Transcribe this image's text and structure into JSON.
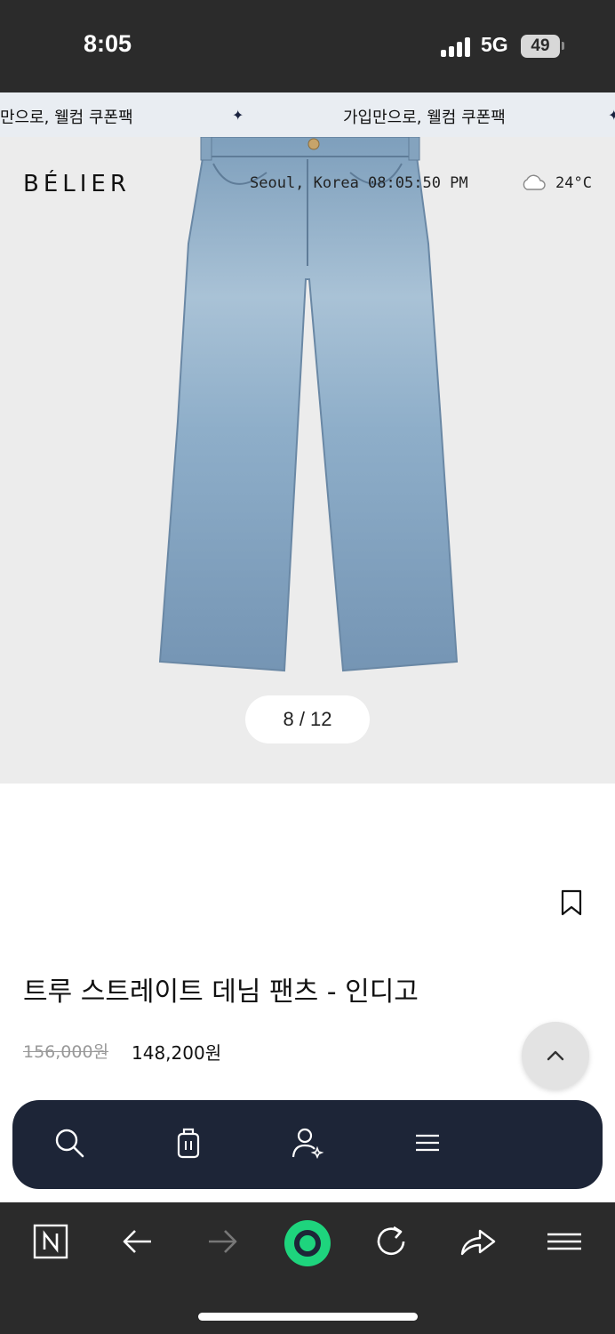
{
  "status_bar": {
    "time": "8:05",
    "network": "5G",
    "battery": "49"
  },
  "marquee": {
    "segments": [
      "만으로, 웰컴 쿠폰팩",
      "가입만으로, 웰컴 쿠폰팩"
    ],
    "separator": "✦"
  },
  "hero": {
    "brand": "BÉLIER",
    "location_time": "Seoul, Korea  08:05:50 PM",
    "temperature": "24°C",
    "weather_icon": "cloud-icon",
    "pager": "8 / 12"
  },
  "product": {
    "title": "트루 스트레이트 데님 팬츠 - 인디고",
    "original_price": "156,000원",
    "sale_price": "148,200원"
  },
  "floating_nav": {
    "icons": [
      "search-icon",
      "shopping-bag-icon",
      "account-sparkle-icon",
      "menu-icon"
    ]
  },
  "browser_bar": {
    "icons": [
      "naver-icon",
      "back-icon",
      "forward-icon",
      "home-circle-icon",
      "refresh-icon",
      "share-icon",
      "menu-icon"
    ]
  },
  "colors": {
    "status_bg": "#2b2b2b",
    "marquee_bg": "#e9edf2",
    "nav_bg": "#1d2537",
    "accent_green": "#1ed47d",
    "denim": "#8fb0c8"
  }
}
